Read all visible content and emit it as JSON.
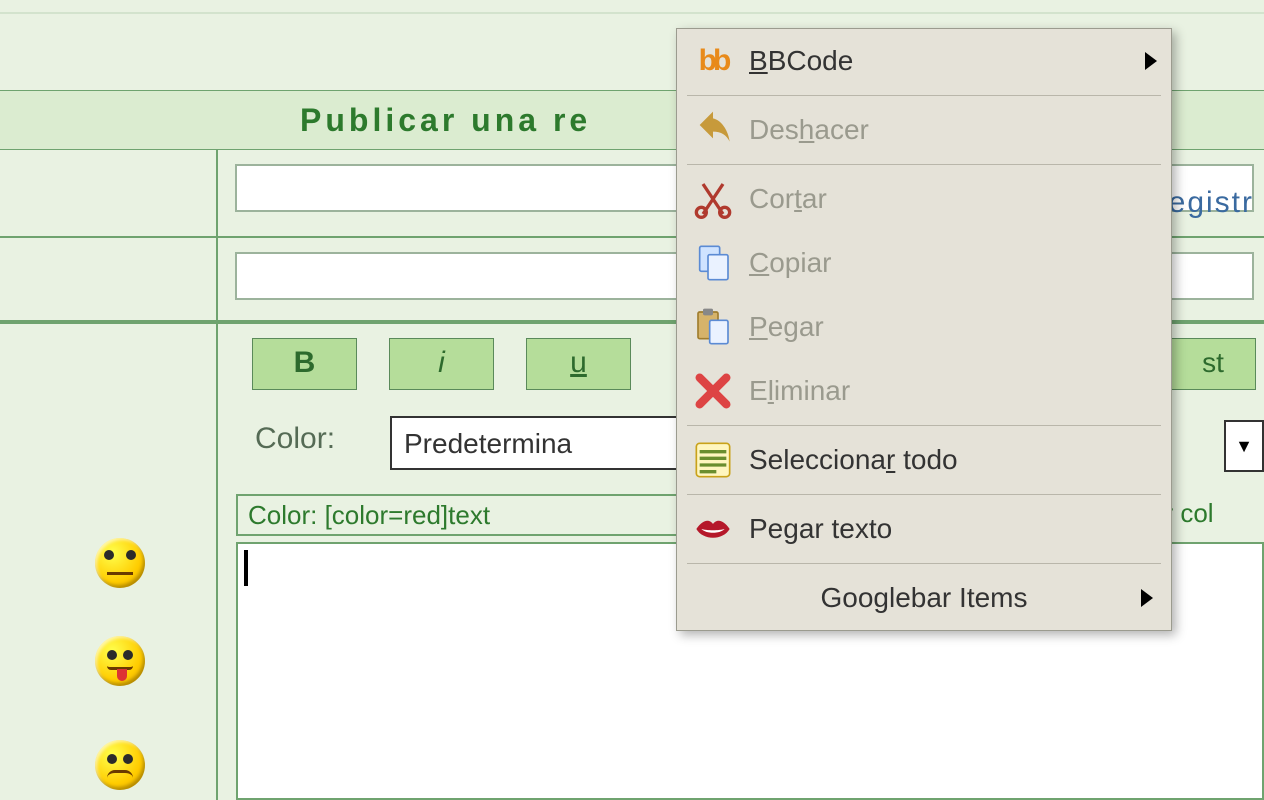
{
  "colors": {
    "accent_green": "#2d7a2d",
    "button_green": "#b5dd9a",
    "border_green": "#6fa36f",
    "panel_bg": "#e9f2e2",
    "menu_bg": "#e5e2d8",
    "disabled_text": "#9a9a8e"
  },
  "header": {
    "title": "Publicar una re",
    "right_link_fragment": "egistr"
  },
  "fields": {
    "field1_value": "",
    "field2_value": ""
  },
  "toolbar": {
    "bold": "B",
    "italic": "i",
    "underline": "u",
    "right_button": "st"
  },
  "color_row": {
    "label": "Color:",
    "selected": "Predetermina"
  },
  "hint": {
    "text_left": "Color: [color=red]text",
    "text_right": "ar col"
  },
  "message_box": {
    "value": ""
  },
  "emoticons": [
    {
      "name": "confused-emoji"
    },
    {
      "name": "tongue-emoji"
    },
    {
      "name": "worried-emoji"
    }
  ],
  "context_menu": {
    "items": [
      {
        "id": "bbcode",
        "icon": "bbcode-icon",
        "label_pre": "",
        "label_ul": "B",
        "label_post": "BCode",
        "enabled": true,
        "submenu": true
      },
      {
        "separator": true
      },
      {
        "id": "undo",
        "icon": "undo-icon",
        "label_pre": "Des",
        "label_ul": "h",
        "label_post": "acer",
        "enabled": false,
        "submenu": false
      },
      {
        "separator": true
      },
      {
        "id": "cut",
        "icon": "cut-icon",
        "label_pre": "Cor",
        "label_ul": "t",
        "label_post": "ar",
        "enabled": false,
        "submenu": false
      },
      {
        "id": "copy",
        "icon": "copy-icon",
        "label_pre": "",
        "label_ul": "C",
        "label_post": "opiar",
        "enabled": false,
        "submenu": false
      },
      {
        "id": "paste",
        "icon": "paste-icon",
        "label_pre": "",
        "label_ul": "P",
        "label_post": "egar",
        "enabled": false,
        "submenu": false
      },
      {
        "id": "delete",
        "icon": "delete-icon",
        "label_pre": "E",
        "label_ul": "l",
        "label_post": "iminar",
        "enabled": false,
        "submenu": false
      },
      {
        "separator": true
      },
      {
        "id": "selectall",
        "icon": "selectall-icon",
        "label_pre": "Selecciona",
        "label_ul": "r",
        "label_post": " todo",
        "enabled": true,
        "submenu": false
      },
      {
        "separator": true
      },
      {
        "id": "pastetext",
        "icon": "lips-icon",
        "label_pre": "Pegar texto",
        "label_ul": "",
        "label_post": "",
        "enabled": true,
        "submenu": false
      },
      {
        "separator": true
      },
      {
        "id": "googlebar",
        "icon": "",
        "label_pre": "Googlebar Items",
        "label_ul": "",
        "label_post": "",
        "enabled": true,
        "submenu": true,
        "centered": true
      }
    ]
  }
}
